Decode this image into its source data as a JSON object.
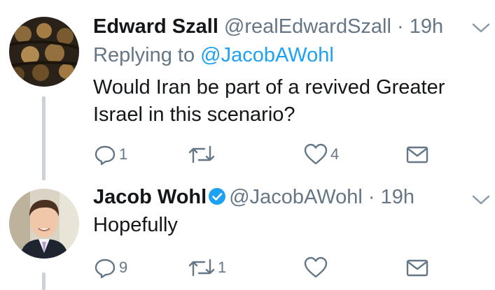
{
  "tweets": [
    {
      "name": "Edward Szall",
      "handle": "@realEdwardSzall",
      "dot": "·",
      "time": "19h",
      "replying_prefix": "Replying to",
      "replying_to": "@JacobAWohl",
      "text": "Would Iran be part of a revived Greater Israel in this scenario?",
      "reply_count": "1",
      "retweet_count": "",
      "like_count": "4",
      "verified": false
    },
    {
      "name": "Jacob Wohl",
      "handle": "@JacobAWohl",
      "dot": "·",
      "time": "19h",
      "text": "Hopefully",
      "reply_count": "9",
      "retweet_count": "1",
      "like_count": "",
      "verified": true
    }
  ],
  "icons": {
    "reply": "reply-icon",
    "retweet": "retweet-icon",
    "like": "heart-icon",
    "dm": "envelope-icon",
    "more": "chevron-down-icon",
    "verified": "verified-badge-icon"
  },
  "colors": {
    "name": "#14171a",
    "secondary": "#657786",
    "link": "#1da1f2",
    "thread_line": "#c9d2d9",
    "verified": "#1da1f2"
  }
}
